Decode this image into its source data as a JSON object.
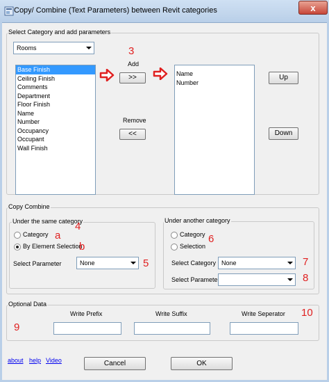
{
  "window": {
    "title": "Copy/ Combine (Text Parameters) between Revit categories",
    "close_glyph": "x"
  },
  "select_category": {
    "group_label": "Select Category and add parameters",
    "category_value": "Rooms",
    "available_items": [
      "Base Finish",
      "Ceiling Finish",
      "Comments",
      "Department",
      "Floor Finish",
      "Name",
      "Number",
      "Occupancy",
      "Occupant",
      "Wall Finish"
    ],
    "selected_index": 0,
    "add_label": "Add",
    "add_button": ">>",
    "remove_label": "Remove",
    "remove_button": "<<",
    "added_items": [
      "Name",
      "Number"
    ],
    "up_button": "Up",
    "down_button": "Down"
  },
  "copy_combine": {
    "group_label": "Copy Combine",
    "same_category": {
      "group_label": "Under the same category",
      "radio_category": "Category",
      "radio_element": "By Element Selection",
      "select_parameter_label": "Select Parameter",
      "select_parameter_value": "None"
    },
    "another_category": {
      "group_label": "Under another category",
      "radio_category": "Category",
      "radio_selection": "Selection",
      "select_category_label": "Select Category",
      "select_category_value": "None",
      "select_parameter_label": "Select Parameter",
      "select_parameter_value": ""
    }
  },
  "optional_data": {
    "group_label": "Optional Data",
    "write_prefix": "Write Prefix",
    "write_suffix": "Write Suffix",
    "write_separator": "Write Seperator"
  },
  "footer": {
    "about": "about",
    "help": "help",
    "video": "Video",
    "cancel": "Cancel",
    "ok": "OK"
  },
  "annotations": {
    "n3": "3",
    "n4": "4",
    "a": "a",
    "b": "b",
    "n5": "5",
    "n6": "6",
    "n7": "7",
    "n8": "8",
    "n9": "9",
    "n10": "10",
    "color": "#e02020"
  },
  "icons": [
    "app-icon",
    "close-icon",
    "dropdown-arrow-icon",
    "red-arrow-icon"
  ]
}
